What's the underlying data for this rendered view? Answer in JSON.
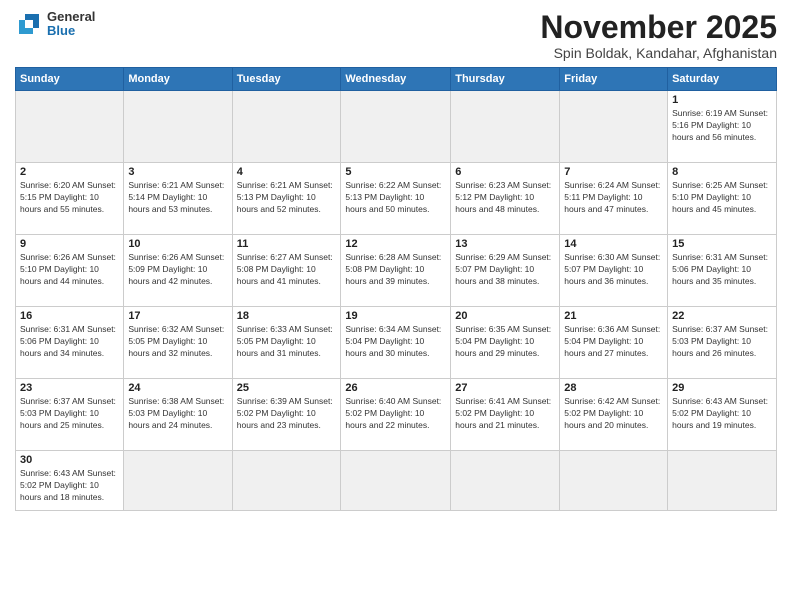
{
  "logo": {
    "general": "General",
    "blue": "Blue"
  },
  "title": "November 2025",
  "subtitle": "Spin Boldak, Kandahar, Afghanistan",
  "days_of_week": [
    "Sunday",
    "Monday",
    "Tuesday",
    "Wednesday",
    "Thursday",
    "Friday",
    "Saturday"
  ],
  "weeks": [
    [
      {
        "day": "",
        "info": ""
      },
      {
        "day": "",
        "info": ""
      },
      {
        "day": "",
        "info": ""
      },
      {
        "day": "",
        "info": ""
      },
      {
        "day": "",
        "info": ""
      },
      {
        "day": "",
        "info": ""
      },
      {
        "day": "1",
        "info": "Sunrise: 6:19 AM\nSunset: 5:16 PM\nDaylight: 10 hours\nand 56 minutes."
      }
    ],
    [
      {
        "day": "2",
        "info": "Sunrise: 6:20 AM\nSunset: 5:15 PM\nDaylight: 10 hours\nand 55 minutes."
      },
      {
        "day": "3",
        "info": "Sunrise: 6:21 AM\nSunset: 5:14 PM\nDaylight: 10 hours\nand 53 minutes."
      },
      {
        "day": "4",
        "info": "Sunrise: 6:21 AM\nSunset: 5:13 PM\nDaylight: 10 hours\nand 52 minutes."
      },
      {
        "day": "5",
        "info": "Sunrise: 6:22 AM\nSunset: 5:13 PM\nDaylight: 10 hours\nand 50 minutes."
      },
      {
        "day": "6",
        "info": "Sunrise: 6:23 AM\nSunset: 5:12 PM\nDaylight: 10 hours\nand 48 minutes."
      },
      {
        "day": "7",
        "info": "Sunrise: 6:24 AM\nSunset: 5:11 PM\nDaylight: 10 hours\nand 47 minutes."
      },
      {
        "day": "8",
        "info": "Sunrise: 6:25 AM\nSunset: 5:10 PM\nDaylight: 10 hours\nand 45 minutes."
      }
    ],
    [
      {
        "day": "9",
        "info": "Sunrise: 6:26 AM\nSunset: 5:10 PM\nDaylight: 10 hours\nand 44 minutes."
      },
      {
        "day": "10",
        "info": "Sunrise: 6:26 AM\nSunset: 5:09 PM\nDaylight: 10 hours\nand 42 minutes."
      },
      {
        "day": "11",
        "info": "Sunrise: 6:27 AM\nSunset: 5:08 PM\nDaylight: 10 hours\nand 41 minutes."
      },
      {
        "day": "12",
        "info": "Sunrise: 6:28 AM\nSunset: 5:08 PM\nDaylight: 10 hours\nand 39 minutes."
      },
      {
        "day": "13",
        "info": "Sunrise: 6:29 AM\nSunset: 5:07 PM\nDaylight: 10 hours\nand 38 minutes."
      },
      {
        "day": "14",
        "info": "Sunrise: 6:30 AM\nSunset: 5:07 PM\nDaylight: 10 hours\nand 36 minutes."
      },
      {
        "day": "15",
        "info": "Sunrise: 6:31 AM\nSunset: 5:06 PM\nDaylight: 10 hours\nand 35 minutes."
      }
    ],
    [
      {
        "day": "16",
        "info": "Sunrise: 6:31 AM\nSunset: 5:06 PM\nDaylight: 10 hours\nand 34 minutes."
      },
      {
        "day": "17",
        "info": "Sunrise: 6:32 AM\nSunset: 5:05 PM\nDaylight: 10 hours\nand 32 minutes."
      },
      {
        "day": "18",
        "info": "Sunrise: 6:33 AM\nSunset: 5:05 PM\nDaylight: 10 hours\nand 31 minutes."
      },
      {
        "day": "19",
        "info": "Sunrise: 6:34 AM\nSunset: 5:04 PM\nDaylight: 10 hours\nand 30 minutes."
      },
      {
        "day": "20",
        "info": "Sunrise: 6:35 AM\nSunset: 5:04 PM\nDaylight: 10 hours\nand 29 minutes."
      },
      {
        "day": "21",
        "info": "Sunrise: 6:36 AM\nSunset: 5:04 PM\nDaylight: 10 hours\nand 27 minutes."
      },
      {
        "day": "22",
        "info": "Sunrise: 6:37 AM\nSunset: 5:03 PM\nDaylight: 10 hours\nand 26 minutes."
      }
    ],
    [
      {
        "day": "23",
        "info": "Sunrise: 6:37 AM\nSunset: 5:03 PM\nDaylight: 10 hours\nand 25 minutes."
      },
      {
        "day": "24",
        "info": "Sunrise: 6:38 AM\nSunset: 5:03 PM\nDaylight: 10 hours\nand 24 minutes."
      },
      {
        "day": "25",
        "info": "Sunrise: 6:39 AM\nSunset: 5:02 PM\nDaylight: 10 hours\nand 23 minutes."
      },
      {
        "day": "26",
        "info": "Sunrise: 6:40 AM\nSunset: 5:02 PM\nDaylight: 10 hours\nand 22 minutes."
      },
      {
        "day": "27",
        "info": "Sunrise: 6:41 AM\nSunset: 5:02 PM\nDaylight: 10 hours\nand 21 minutes."
      },
      {
        "day": "28",
        "info": "Sunrise: 6:42 AM\nSunset: 5:02 PM\nDaylight: 10 hours\nand 20 minutes."
      },
      {
        "day": "29",
        "info": "Sunrise: 6:43 AM\nSunset: 5:02 PM\nDaylight: 10 hours\nand 19 minutes."
      }
    ],
    [
      {
        "day": "30",
        "info": "Sunrise: 6:43 AM\nSunset: 5:02 PM\nDaylight: 10 hours\nand 18 minutes."
      },
      {
        "day": "",
        "info": ""
      },
      {
        "day": "",
        "info": ""
      },
      {
        "day": "",
        "info": ""
      },
      {
        "day": "",
        "info": ""
      },
      {
        "day": "",
        "info": ""
      },
      {
        "day": "",
        "info": ""
      }
    ]
  ]
}
